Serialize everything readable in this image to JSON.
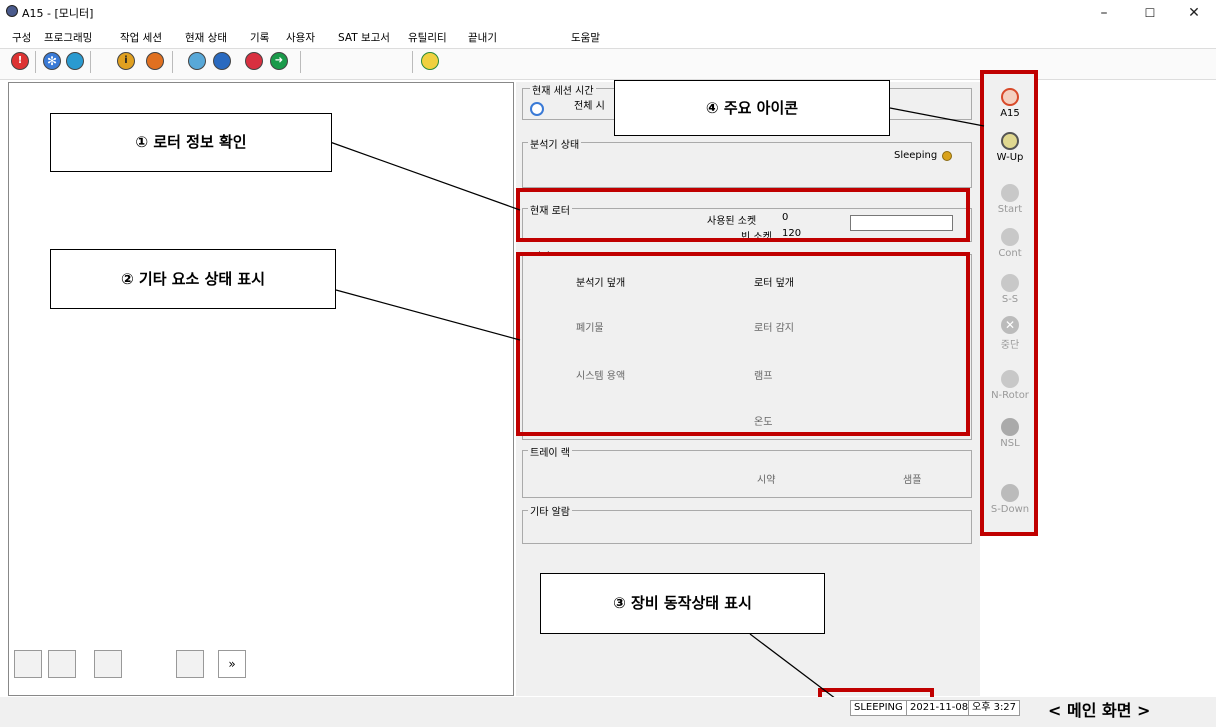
{
  "window": {
    "title": "A15 - [모니터]",
    "minimize": "–",
    "maximize": "☐",
    "close": "✕"
  },
  "menu": {
    "items": [
      "구성",
      "프로그래밍",
      "작업 세션",
      "현재 상태",
      "기록",
      "사용자",
      "SAT 보고서",
      "유틸리티",
      "끝내기"
    ],
    "help": "도움말"
  },
  "toolbar": {
    "icons": [
      "alarm-icon",
      "snowflake-icon",
      "globe-icon",
      "info-icon",
      "wheel-icon",
      "eye-icon",
      "drive-icon",
      "stop-icon",
      "arrow-icon",
      "sun-icon"
    ]
  },
  "monitor": {
    "session_time_label": "현재 세션 시간",
    "total_label": "전체 시",
    "analyzer_status_label": "분석기 상태",
    "analyzer_status_value": "Sleeping",
    "current_rotor_label": "현재 로터",
    "used_sockets_label": "사용된 소켓",
    "used_sockets_value": "0",
    "empty_sockets_label": "빈 소켓",
    "empty_sockets_value": "120",
    "other_elements_label": "기타 요소",
    "analyzer_cover": "분석기 덮개",
    "rotor_cover": "로터 덮개",
    "waste": "폐기물",
    "rotor_detect": "로터 감지",
    "system_solution": "시스템 용액",
    "lamp": "램프",
    "temperature": "온도",
    "tray_rack_label": "트레이 랙",
    "reagent": "시약",
    "sample": "샘플",
    "other_alarm_label": "기타 알람"
  },
  "icon_bar": [
    {
      "label": "A15",
      "icon": "a15-icon",
      "active": true
    },
    {
      "label": "W-Up",
      "icon": "warmup-icon",
      "active": true
    },
    {
      "label": "Start",
      "icon": "start-icon",
      "active": false
    },
    {
      "label": "Cont",
      "icon": "continue-icon",
      "active": false
    },
    {
      "label": "S-S",
      "icon": "start-stop-icon",
      "active": false
    },
    {
      "label": "중단",
      "icon": "abort-icon",
      "active": false
    },
    {
      "label": "N-Rotor",
      "icon": "new-rotor-icon",
      "active": false
    },
    {
      "label": "NSL",
      "icon": "nsl-icon",
      "active": false
    },
    {
      "label": "S-Down",
      "icon": "shutdown-icon",
      "active": false
    }
  ],
  "callouts": {
    "rotor_info": "① 로터 정보 확인",
    "other_status": "② 기타 요소 상태 표시",
    "device_status": "③ 장비 동작상태 표시",
    "main_icons": "④ 주요 아이콘"
  },
  "left_buttons": {
    "expand": "»"
  },
  "statusbar": {
    "state": "SLEEPING",
    "date": "2021-11-08",
    "time": "오후 3:27"
  },
  "caption": "< 메인 화면 >",
  "colors": {
    "highlight_red": "#c00000",
    "status_dot": "#d9a21b"
  }
}
